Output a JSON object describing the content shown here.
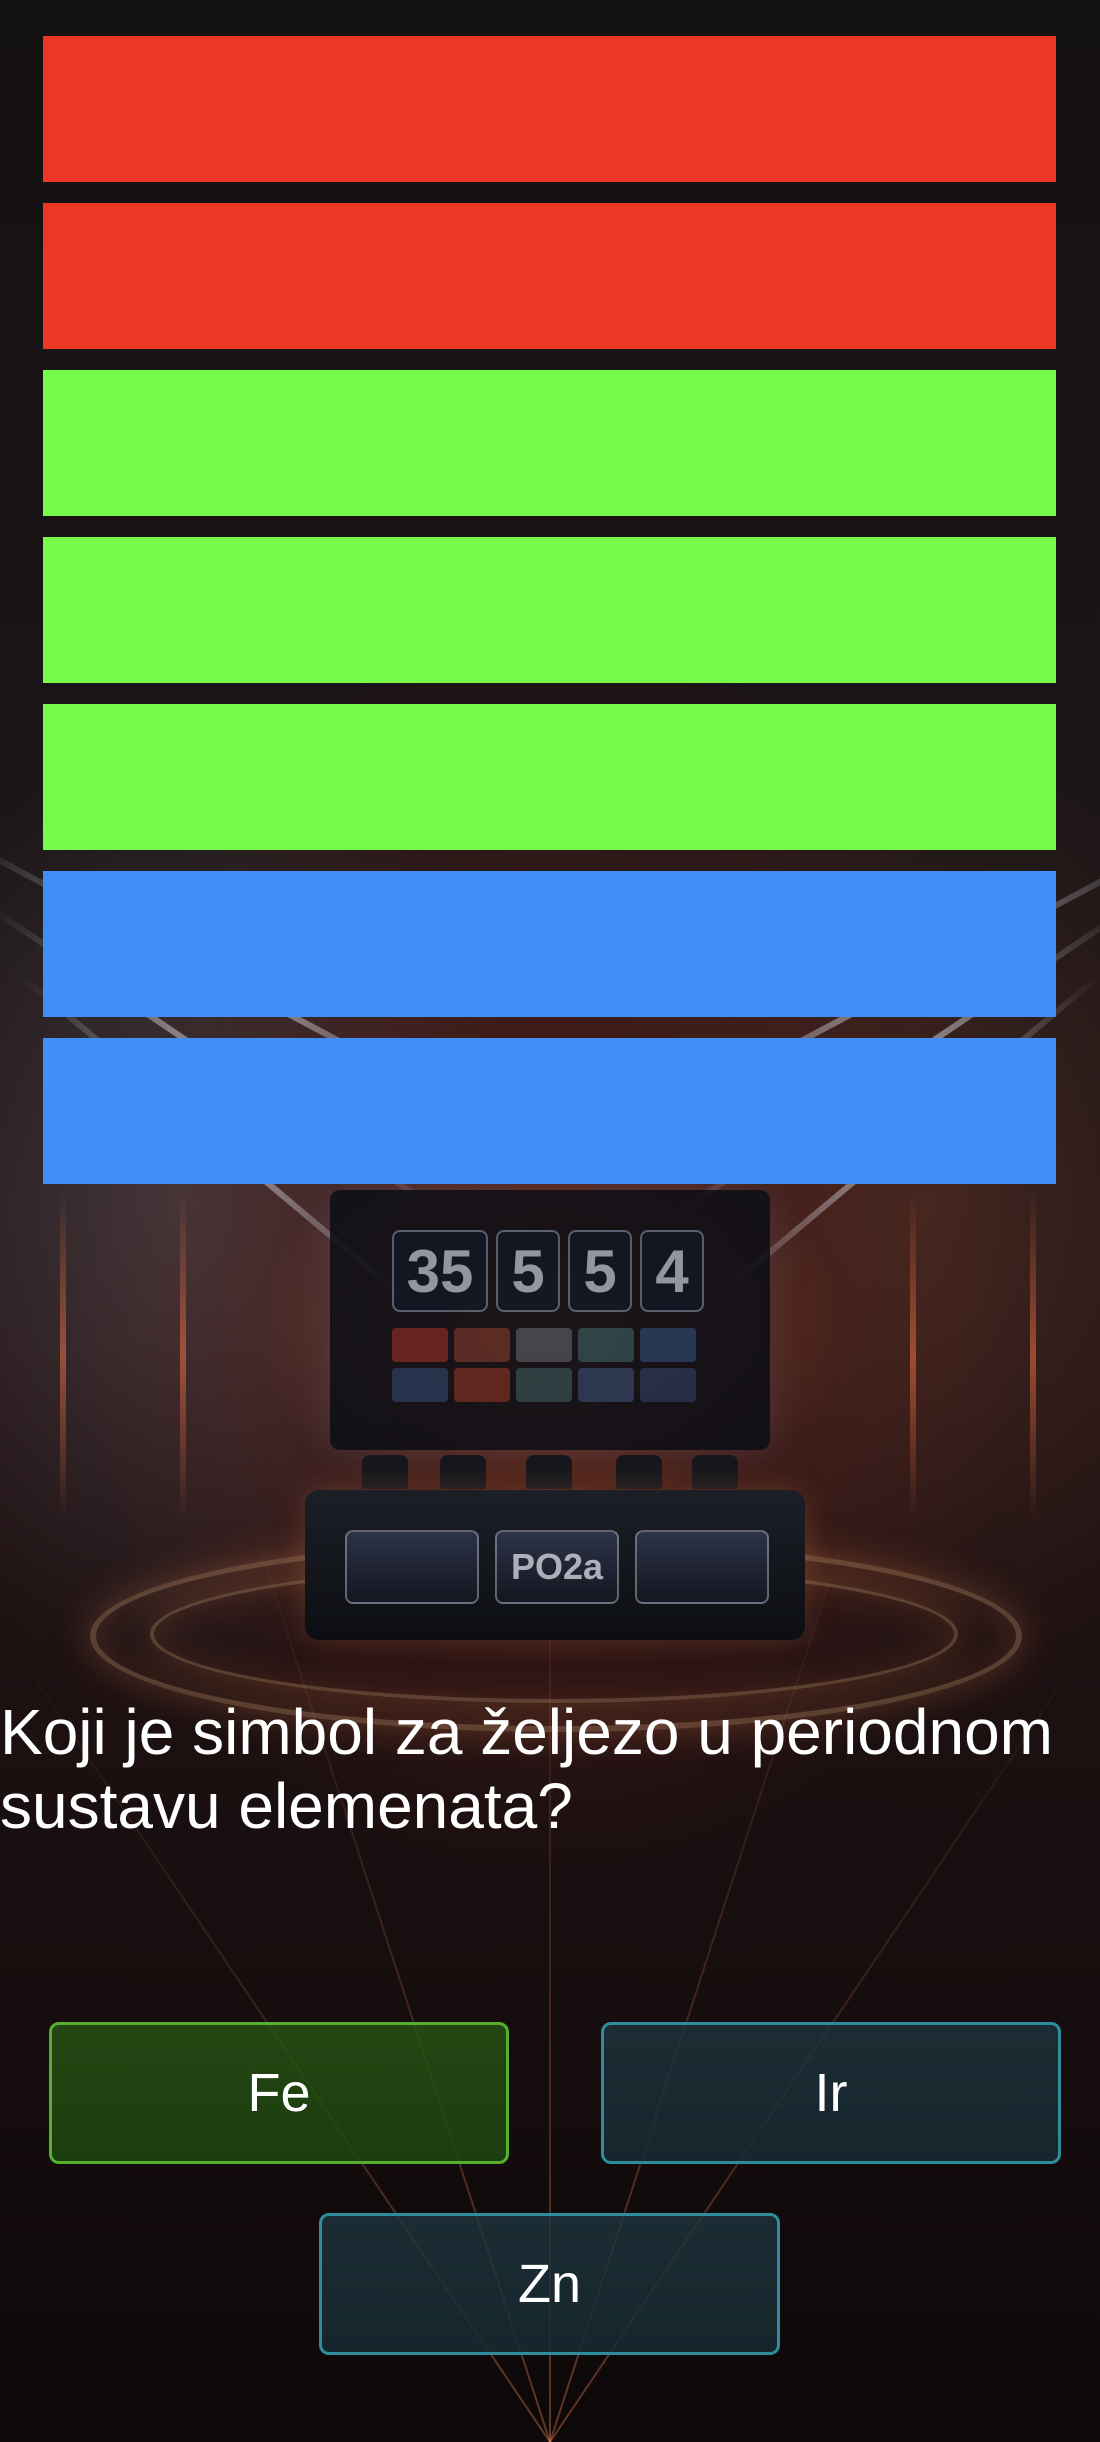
{
  "progress_bars": [
    {
      "color": "#ee3624"
    },
    {
      "color": "#ee3624"
    },
    {
      "color": "#77fb4a"
    },
    {
      "color": "#77fb4a"
    },
    {
      "color": "#77fb4a"
    },
    {
      "color": "#418ef8"
    },
    {
      "color": "#418ef8"
    }
  ],
  "background": {
    "scoreboard_digits": [
      "35",
      "5",
      "5",
      "4"
    ],
    "podium_text": "PO2a"
  },
  "question": {
    "text": "Koji je simbol za željezo u periodnom sustavu elemenata?"
  },
  "answers": [
    {
      "label": "Fe",
      "state": "correct",
      "color": "#56b02f"
    },
    {
      "label": "Ir",
      "state": "neutral",
      "color": "#2f8c9a"
    },
    {
      "label": "Zn",
      "state": "neutral",
      "color": "#2f8c9a"
    }
  ]
}
